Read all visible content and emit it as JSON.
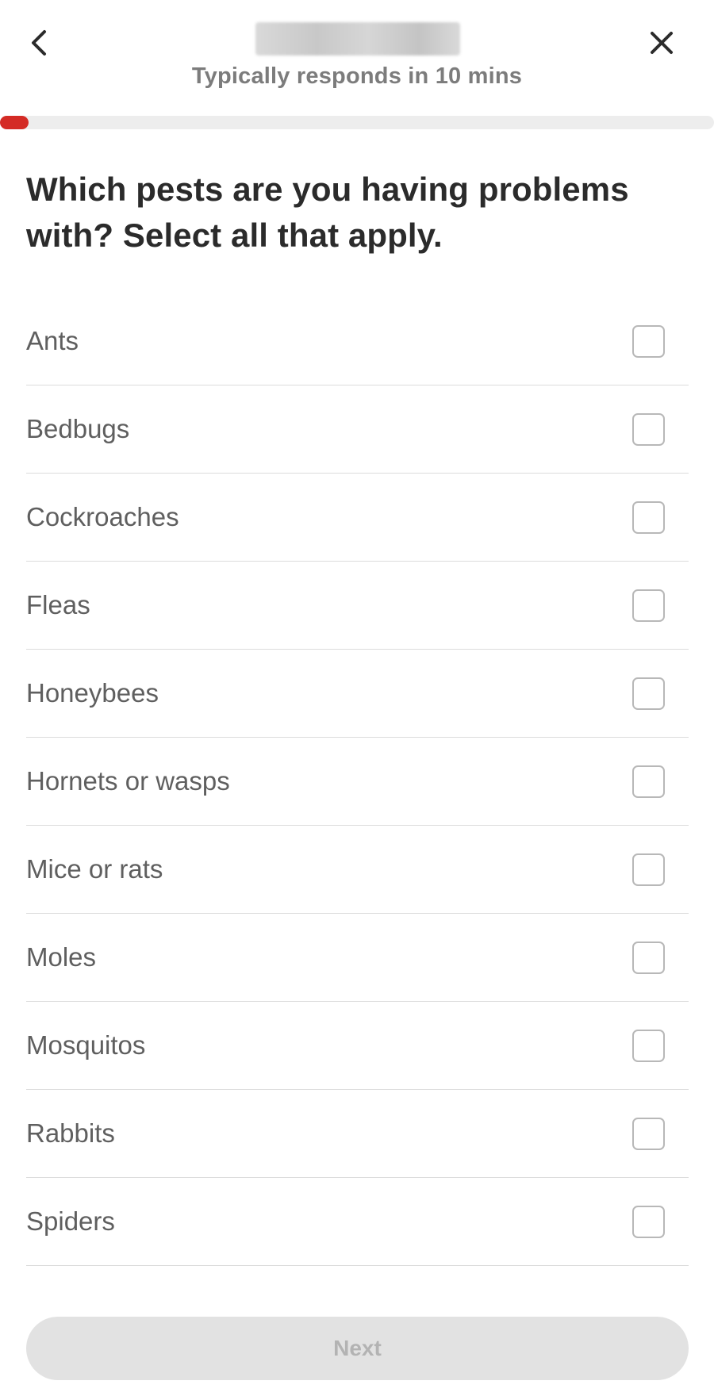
{
  "header": {
    "response_time": "Typically responds in 10 mins"
  },
  "progress": {
    "fraction": 0.04,
    "color": "#d42b25"
  },
  "question": "Which pests are you having problems with? Select all that apply.",
  "options": [
    {
      "label": "Ants",
      "checked": false
    },
    {
      "label": "Bedbugs",
      "checked": false
    },
    {
      "label": "Cockroaches",
      "checked": false
    },
    {
      "label": "Fleas",
      "checked": false
    },
    {
      "label": "Honeybees",
      "checked": false
    },
    {
      "label": "Hornets or wasps",
      "checked": false
    },
    {
      "label": "Mice or rats",
      "checked": false
    },
    {
      "label": "Moles",
      "checked": false
    },
    {
      "label": "Mosquitos",
      "checked": false
    },
    {
      "label": "Rabbits",
      "checked": false
    },
    {
      "label": "Spiders",
      "checked": false
    }
  ],
  "footer": {
    "next_label": "Next",
    "next_enabled": false
  },
  "icons": {
    "back": "chevron-left-icon",
    "close": "close-icon"
  }
}
